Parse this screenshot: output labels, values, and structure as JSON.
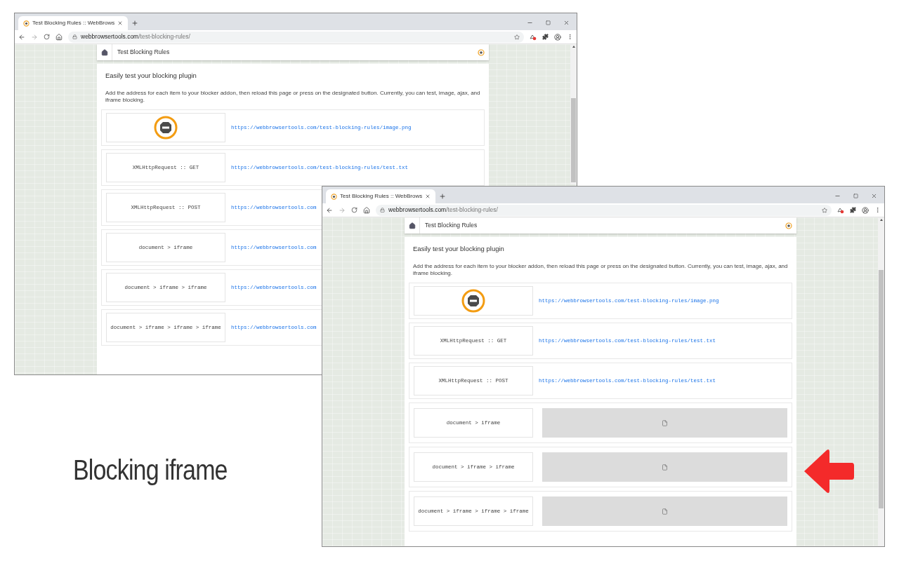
{
  "windows": [
    {
      "tab_title": "Test Blocking Rules :: WebBrows",
      "url_domain": "webbrowsertools.com",
      "url_path": "/test-blocking-rules/",
      "header_title": "Test Blocking Rules",
      "heading": "Easily test your blocking plugin",
      "description": "Add the address for each item to your blocker addon, then reload this page or press on the designated button. Currently, you can test, image, ajax, and iframe blocking.",
      "rows": [
        {
          "kind": "image",
          "link": "https://webbrowsertools.com/test-blocking-rules/image.png"
        },
        {
          "kind": "text",
          "label": "XMLHttpRequest :: GET",
          "link": "https://webbrowsertools.com/test-blocking-rules/test.txt"
        },
        {
          "kind": "text",
          "label": "XMLHttpRequest :: POST",
          "link": "https://webbrowsertools.com"
        },
        {
          "kind": "text",
          "label": "document > iframe",
          "link": "https://webbrowsertools.com"
        },
        {
          "kind": "text",
          "label": "document > iframe > iframe",
          "link": "https://webbrowsertools.com"
        },
        {
          "kind": "text",
          "label": "document > iframe > iframe > iframe",
          "link": "https://webbrowsertools.com"
        }
      ]
    },
    {
      "tab_title": "Test Blocking Rules :: WebBrows",
      "url_domain": "webbrowsertools.com",
      "url_path": "/test-blocking-rules/",
      "header_title": "Test Blocking Rules",
      "heading": "Easily test your blocking plugin",
      "description": "Add the address for each item to your blocker addon, then reload this page or press on the designated button. Currently, you can test, image, ajax, and iframe blocking.",
      "rows": [
        {
          "kind": "image",
          "link": "https://webbrowsertools.com/test-blocking-rules/image.png"
        },
        {
          "kind": "text",
          "label": "XMLHttpRequest :: GET",
          "link": "https://webbrowsertools.com/test-blocking-rules/test.txt"
        },
        {
          "kind": "text",
          "label": "XMLHttpRequest :: POST",
          "link": "https://webbrowsertools.com/test-blocking-rules/test.txt"
        },
        {
          "kind": "iframe",
          "label": "document > iframe"
        },
        {
          "kind": "iframe",
          "label": "document > iframe > iframe"
        },
        {
          "kind": "iframe",
          "label": "document > iframe > iframe > iframe"
        }
      ]
    }
  ],
  "caption": "Blocking iframe"
}
